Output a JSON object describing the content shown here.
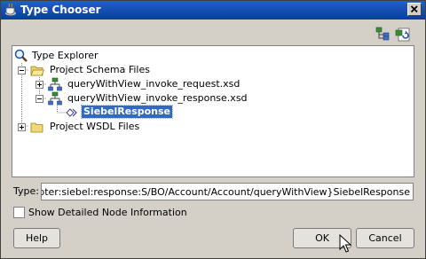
{
  "window": {
    "title": "Type Chooser",
    "app_icon": "coffee-cup-icon",
    "close_icon": "close-icon"
  },
  "toolbar": {
    "icons": [
      "hierarchy-tree-icon",
      "refresh-schema-icon"
    ]
  },
  "tree": {
    "root_label": "Type Explorer",
    "project_schema": {
      "label": "Project Schema Files",
      "children": [
        {
          "label": "queryWithView_invoke_request.xsd",
          "expanded": false
        },
        {
          "label": "queryWithView_invoke_response.xsd",
          "expanded": true,
          "children": [
            {
              "label": "SiebelResponse",
              "selected": true
            }
          ]
        }
      ]
    },
    "project_wsdl": {
      "label": "Project WSDL Files",
      "expanded": false
    }
  },
  "type_field": {
    "label": "Type:",
    "value": "ware:adapter:siebel:response:S/BO/Account/Account/queryWithView}SiebelResponse"
  },
  "show_details": {
    "label": "Show Detailed Node Information",
    "checked": false
  },
  "buttons": {
    "help": "Help",
    "ok": "OK",
    "cancel": "Cancel"
  },
  "colors": {
    "title_bar": "#0a3e9a",
    "selection": "#3069c6",
    "dialog_bg": "#d4d0c8"
  }
}
